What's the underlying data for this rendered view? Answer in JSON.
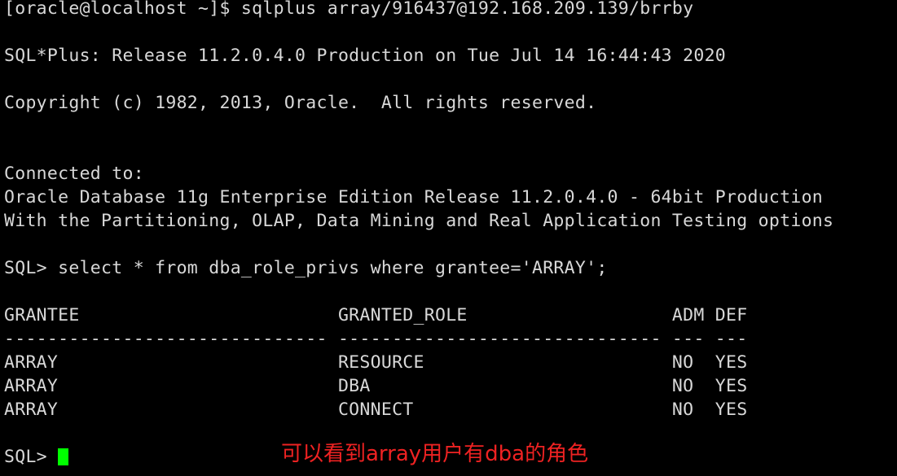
{
  "terminal": {
    "background_color": "#000000",
    "foreground_color": "#d8d8d8",
    "cursor_color": "#00ff00",
    "annotation_color": "#ee2222"
  },
  "lines": {
    "shell_prompt_command": "[oracle@localhost ~]$ sqlplus array/916437@192.168.209.139/brrby",
    "blank_1": "",
    "sqlplus_release": "SQL*Plus: Release 11.2.0.4.0 Production on Tue Jul 14 16:44:43 2020",
    "blank_2": "",
    "copyright": "Copyright (c) 1982, 2013, Oracle.  All rights reserved.",
    "blank_3": "",
    "blank_4": "",
    "connected_to": "Connected to:",
    "db_version": "Oracle Database 11g Enterprise Edition Release 11.2.0.4.0 - 64bit Production",
    "db_options": "With the Partitioning, OLAP, Data Mining and Real Application Testing options",
    "blank_5": "",
    "sql_query": "SQL> select * from dba_role_privs where grantee='ARRAY';",
    "blank_6": "",
    "table_header": "GRANTEE                        GRANTED_ROLE                   ADM DEF",
    "table_separator": "------------------------------ ------------------------------ --- ---",
    "row_1": "ARRAY                          RESOURCE                       NO  YES",
    "row_2": "ARRAY                          DBA                            NO  YES",
    "row_3": "ARRAY                          CONNECT                        NO  YES",
    "blank_7": "",
    "final_prompt": "SQL> "
  },
  "table": {
    "columns": [
      "GRANTEE",
      "GRANTED_ROLE",
      "ADM",
      "DEF"
    ],
    "rows": [
      [
        "ARRAY",
        "RESOURCE",
        "NO",
        "YES"
      ],
      [
        "ARRAY",
        "DBA",
        "NO",
        "YES"
      ],
      [
        "ARRAY",
        "CONNECT",
        "NO",
        "YES"
      ]
    ]
  },
  "annotation": {
    "text": "可以看到array用户有dba的角色"
  }
}
